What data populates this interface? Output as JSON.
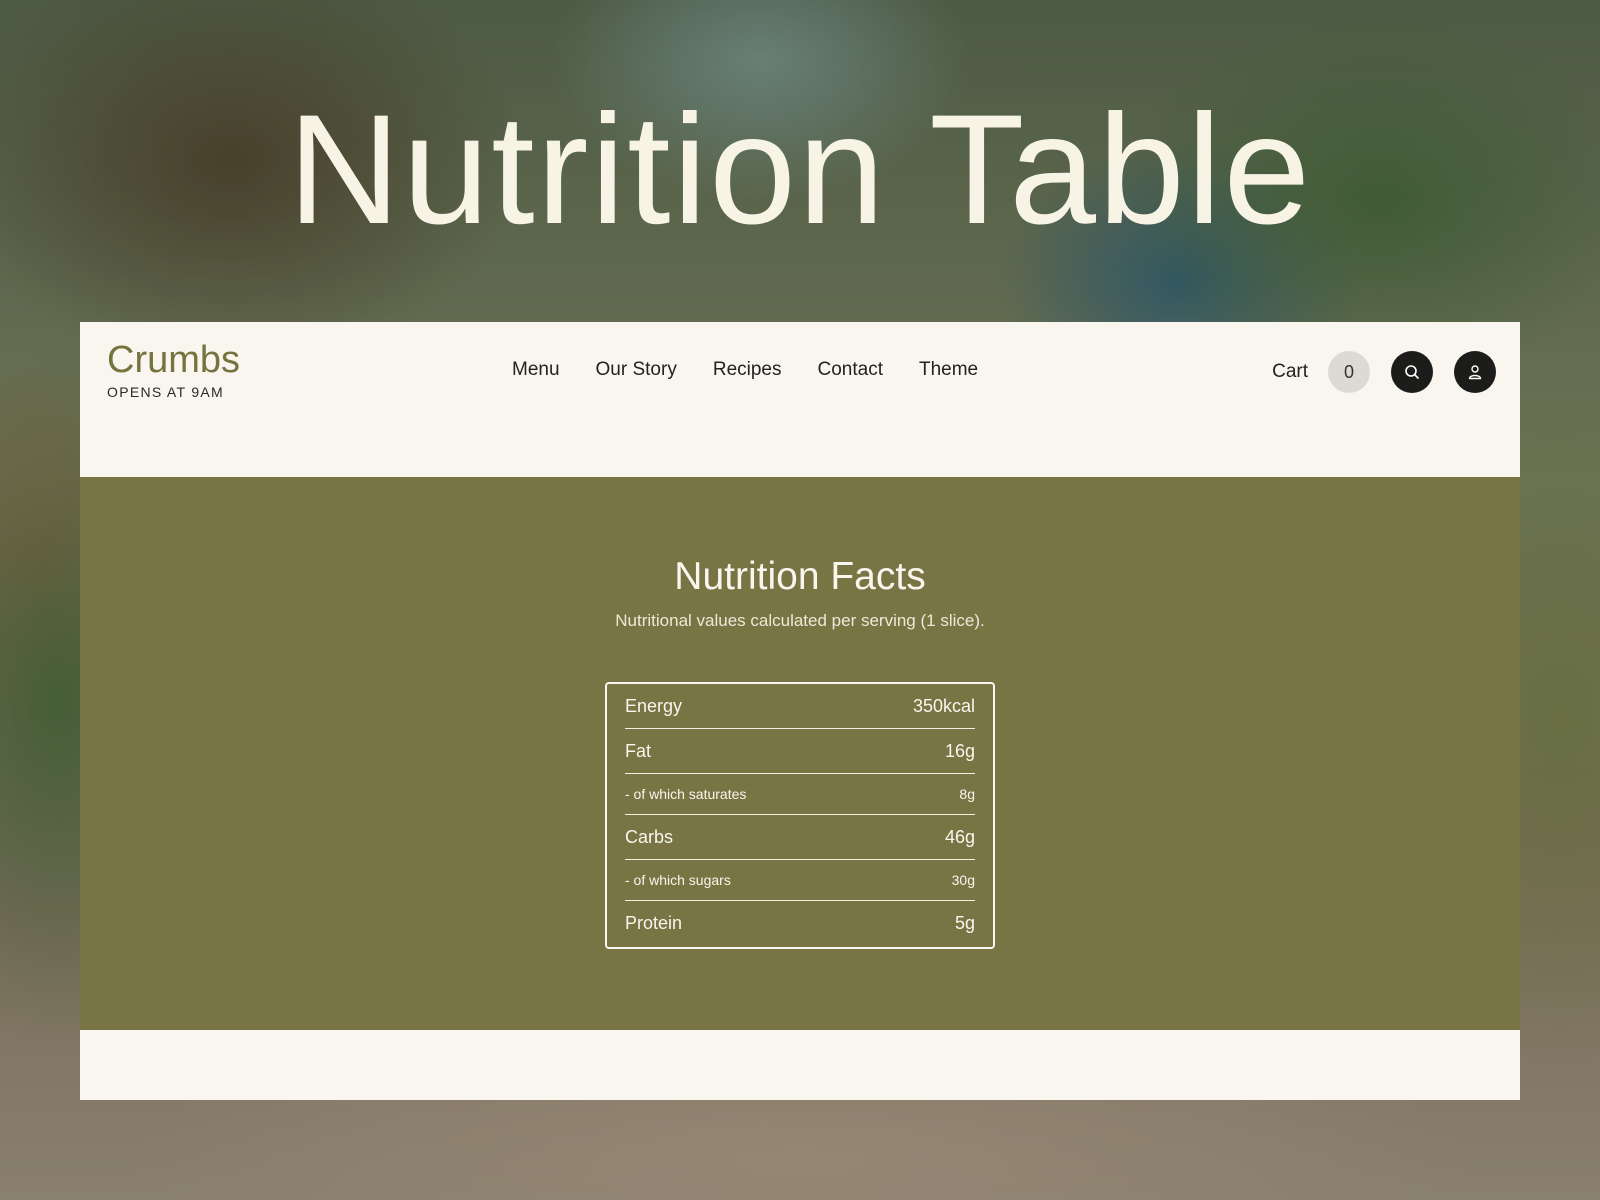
{
  "hero": {
    "title": "Nutrition Table"
  },
  "site": {
    "brand": "Crumbs",
    "tagline": "OPENS AT 9AM",
    "nav": [
      "Menu",
      "Our Story",
      "Recipes",
      "Contact",
      "Theme"
    ],
    "cart_label": "Cart",
    "cart_count": "0",
    "icons": {
      "search": "search-icon",
      "account": "user-icon"
    }
  },
  "nutrition": {
    "title": "Nutrition Facts",
    "subtitle": "Nutritional values calculated per serving (1 slice).",
    "rows": [
      {
        "label": "Energy",
        "value": "350kcal"
      },
      {
        "label": "Fat",
        "value": "16g"
      },
      {
        "label": "- of which saturates",
        "value": "8g"
      },
      {
        "label": "Carbs",
        "value": "46g"
      },
      {
        "label": "- of which sugars",
        "value": "30g"
      },
      {
        "label": "Protein",
        "value": "5g"
      }
    ]
  },
  "colors": {
    "brand_olive": "#787443",
    "cream": "#f8f6ee",
    "dark_button": "#1c1c1a"
  }
}
